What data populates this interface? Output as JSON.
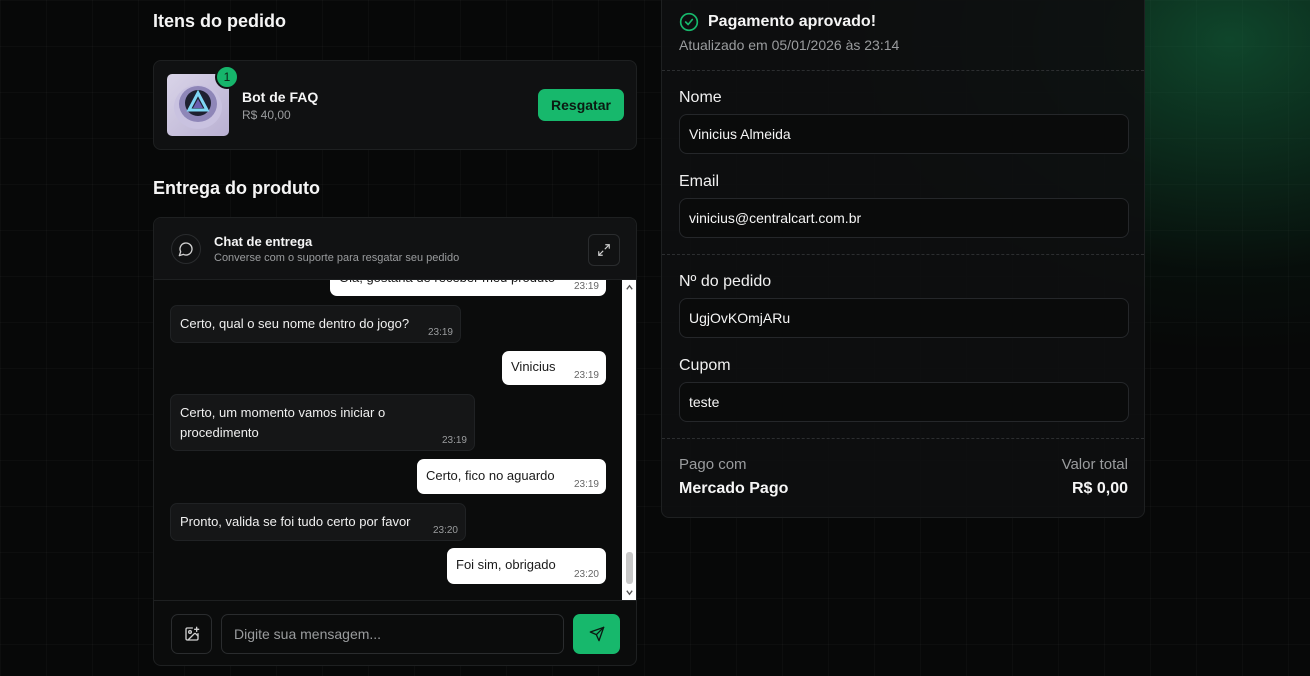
{
  "order_items": {
    "title": "Itens do pedido",
    "items": [
      {
        "name": "Bot de FAQ",
        "price": "R$ 40,00",
        "quantity": "1",
        "action_label": "Resgatar"
      }
    ]
  },
  "delivery": {
    "title": "Entrega do produto",
    "chat": {
      "title": "Chat de entrega",
      "subtitle": "Converse com o suporte para resgatar seu pedido",
      "messages": [
        {
          "direction": "out",
          "text": "Olá, gostaria de receber meu produto",
          "time": "23:19"
        },
        {
          "direction": "in",
          "text": "Certo, qual o seu nome dentro do jogo?",
          "time": "23:19"
        },
        {
          "direction": "out",
          "text": "Vinicius",
          "time": "23:19"
        },
        {
          "direction": "in",
          "text": "Certo, um momento vamos iniciar o procedimento",
          "time": "23:19"
        },
        {
          "direction": "out",
          "text": "Certo, fico no aguardo",
          "time": "23:19"
        },
        {
          "direction": "in",
          "text": "Pronto, valida se foi tudo certo por favor",
          "time": "23:20"
        },
        {
          "direction": "out",
          "text": "Foi sim, obrigado",
          "time": "23:20"
        }
      ],
      "input_placeholder": "Digite sua mensagem..."
    }
  },
  "payment": {
    "status_title": "Pagamento aprovado!",
    "status_updated": "Atualizado em 05/01/2026 às 23:14",
    "fields": {
      "name_label": "Nome",
      "name_value": "Vinicius Almeida",
      "email_label": "Email",
      "email_value": "vinicius@centralcart.com.br",
      "order_label": "Nº do pedido",
      "order_value": "UgjOvKOmjARu",
      "coupon_label": "Cupom",
      "coupon_value": "teste"
    },
    "paid_with_label": "Pago com",
    "paid_with_value": "Mercado Pago",
    "total_label": "Valor total",
    "total_value": "R$ 0,00"
  },
  "colors": {
    "accent": "#17b86c",
    "background": "#070808",
    "card": "#101112"
  },
  "icons": [
    "check-circle-icon",
    "chat-bubble-icon",
    "expand-icon",
    "image-add-icon",
    "send-icon",
    "scroll-up-icon",
    "scroll-down-icon"
  ]
}
